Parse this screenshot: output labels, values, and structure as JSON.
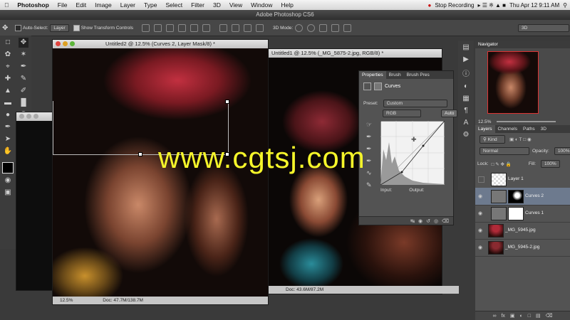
{
  "menubar": {
    "app_name": "Photoshop",
    "items": [
      "File",
      "Edit",
      "Image",
      "Layer",
      "Type",
      "Select",
      "Filter",
      "3D",
      "View",
      "Window",
      "Help"
    ],
    "stop_recording": "Stop Recording",
    "datetime": "Thu Apr 12  9:11 AM"
  },
  "app_title": "Adobe Photoshop CS6",
  "options": {
    "auto_select_label": "Auto-Select:",
    "auto_select_value": "Layer",
    "show_transform_label": "Show Transform Controls",
    "mode_label": "3D Mode:",
    "workspace": "3D"
  },
  "doc1": {
    "title": "Untitled2 @ 12.5% (Curves 2, Layer Mask/8) *",
    "zoom": "12.5%",
    "doc_size": "Doc: 47.7M/138.7M"
  },
  "doc2": {
    "title": "Untitled1 @ 12.5% (_MG_5875-2.jpg, RGB/8) *",
    "doc_size": "Doc: 43.6M/87.2M"
  },
  "properties": {
    "tabs": [
      "Properties",
      "Brush",
      "Brush Pres"
    ],
    "panel_name": "Curves",
    "preset_label": "Preset:",
    "preset_value": "Custom",
    "channel": "RGB",
    "auto_label": "Auto",
    "input_label": "Input:",
    "output_label": "Output:"
  },
  "navigator": {
    "title": "Navigator",
    "zoom": "12.5%"
  },
  "layers": {
    "tabs": [
      "Layers",
      "Channels",
      "Paths",
      "3D"
    ],
    "kind_label": "Kind",
    "blend_mode": "Normal",
    "opacity_label": "Opacity:",
    "opacity": "100%",
    "lock_label": "Lock:",
    "fill_label": "Fill:",
    "fill": "100%",
    "items": [
      {
        "name": "Layer 1"
      },
      {
        "name": "Curves 2"
      },
      {
        "name": "Curves 1"
      },
      {
        "name": "_MG_5945.jpg"
      },
      {
        "name": "_MG_5945-2.jpg"
      }
    ]
  },
  "watermark": "www.cgtsj.com",
  "colors": {
    "accent_watermark": "#f5f52a",
    "panel_bg": "#535353",
    "dark_bg": "#3a3a3a"
  }
}
